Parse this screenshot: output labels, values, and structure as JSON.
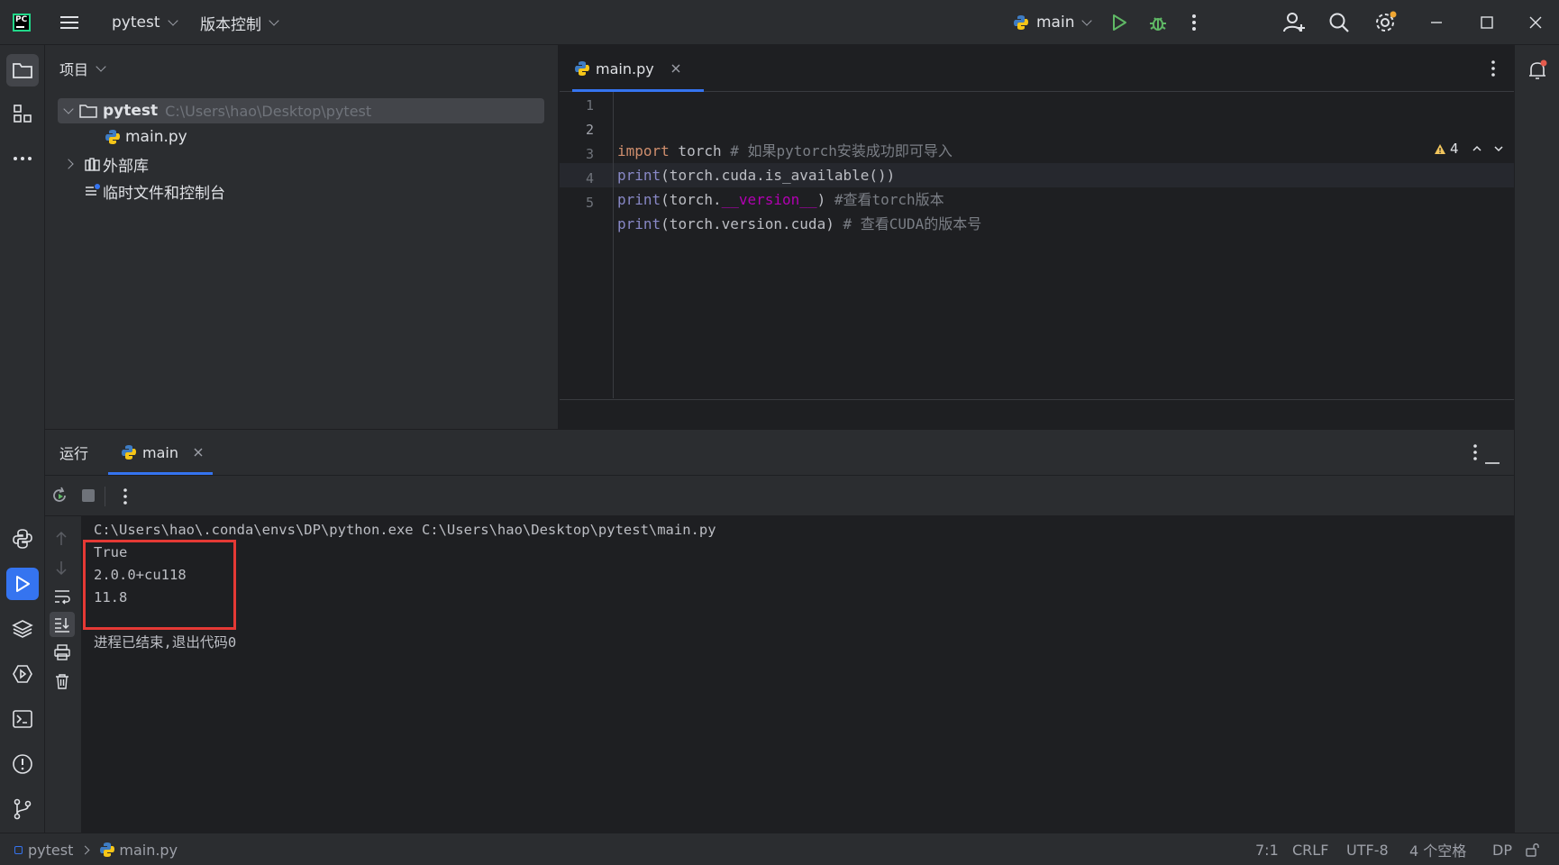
{
  "titlebar": {
    "project_label": "pytest",
    "vcs_label": "版本控制",
    "run_config_label": "main"
  },
  "project_panel": {
    "header": "项目",
    "tree": [
      {
        "label": "pytest",
        "path": "C:\\Users\\hao\\Desktop\\pytest"
      },
      {
        "label": "main.py"
      },
      {
        "label": "外部库"
      },
      {
        "label": "临时文件和控制台"
      }
    ]
  },
  "editor": {
    "tab_label": "main.py",
    "warnings_count": "4",
    "line_numbers": [
      "1",
      "2",
      "3",
      "4",
      "5"
    ],
    "lines": [
      {
        "kw": "import",
        "rest": " torch",
        "comment": " # 如果pytorch安装成功即可导入"
      },
      {
        "fn": "print",
        "rest": "(torch.cuda.is_available())"
      },
      {
        "fn": "print",
        "rest_a": "(torch.",
        "dunder": "__version__",
        "rest_b": ") ",
        "comment": "#查看torch版本"
      },
      {
        "fn": "print",
        "rest": "(torch.version.cuda)",
        "comment": " # 查看CUDA的版本号"
      }
    ]
  },
  "run_panel": {
    "run_tab_label": "运行",
    "config_tab_label": "main",
    "console": {
      "command": "C:\\Users\\hao\\.conda\\envs\\DP\\python.exe C:\\Users\\hao\\Desktop\\pytest\\main.py",
      "output": [
        "True",
        "2.0.0+cu118",
        "11.8"
      ],
      "exit_message": "进程已结束,退出代码0"
    }
  },
  "statusbar": {
    "breadcrumb_project": "pytest",
    "breadcrumb_file": "main.py",
    "caret_position": "7:1",
    "line_separator": "CRLF",
    "encoding": "UTF-8",
    "indent": "4 个空格",
    "interpreter": "DP"
  },
  "colors": {
    "accent": "#3574f0",
    "run_green": "#5fb865",
    "highlight_box": "#e53935",
    "notification_dot": "#e55b4d"
  }
}
